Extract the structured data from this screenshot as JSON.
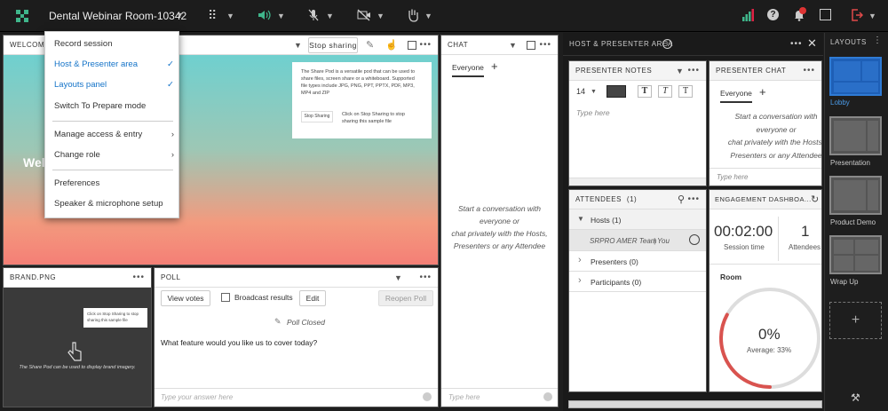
{
  "topbar": {
    "room_title": "Dental Webinar Room-10342"
  },
  "share_pod": {
    "header": "WELCOME...",
    "stop_sharing": "Stop sharing",
    "welcome_partial": "Welc",
    "note_lines": [
      "The Share Pod is a versatile pod that can be used to",
      "share files, screen share or a whiteboard. Supported",
      "file types include JPG, PNG, PPT, PPTX, PDF, MP3,",
      "MP4 and ZIP"
    ],
    "note_btn": "Stop Sharing",
    "note_hint_lines": [
      "Click on Stop Sharing to stop",
      "sharing this sample file"
    ]
  },
  "menu": {
    "items": [
      {
        "label": "Record session",
        "checked": false
      },
      {
        "label": "Host & Presenter area",
        "checked": true
      },
      {
        "label": "Layouts panel",
        "checked": true
      },
      {
        "label": "Switch To Prepare mode"
      },
      {
        "label": "Manage access & entry"
      },
      {
        "label": "Change role"
      },
      {
        "label": "Preferences"
      },
      {
        "label": "Speaker & microphone setup"
      }
    ],
    "check": "✓",
    "arrow": "›"
  },
  "brand_pod": {
    "header": "BRAND.PNG",
    "hint_lines": [
      "Click on Stop Sharing to stop",
      "sharing this sample file"
    ],
    "caption": "The Share Pod can be used to display brand imagery."
  },
  "poll_pod": {
    "header": "POLL",
    "view_votes": "View votes",
    "broadcast": "Broadcast results",
    "edit": "Edit",
    "reopen": "Reopen Poll",
    "status": "Poll Closed",
    "question": "What feature would you like us to cover today?",
    "answer_placeholder": "Type your answer here"
  },
  "chat_pod": {
    "header": "CHAT",
    "tab": "Everyone",
    "plus": "+",
    "empty_lines": [
      "Start a conversation with",
      "everyone or",
      "chat privately with the Hosts,",
      "Presenters or any Attendee"
    ],
    "input_placeholder": "Type here"
  },
  "host_area": {
    "header": "HOST & PRESENTER AREA",
    "notes": {
      "header": "PRESENTER NOTES",
      "font_size": "14",
      "t1": "T",
      "t2": "T",
      "t3": "T",
      "placeholder": "Type here"
    },
    "pchat": {
      "header": "PRESENTER CHAT",
      "tab": "Everyone",
      "plus": "+",
      "empty_lines": [
        "Start a conversation with",
        "everyone or",
        "chat privately with the Hosts,",
        "Presenters or any Attendee"
      ],
      "input_placeholder": "Type here"
    },
    "attendees": {
      "header": "ATTENDEES",
      "count": "(1)",
      "hosts": "Hosts (1)",
      "member": "SRPRO AMER Team",
      "member_role": "| You",
      "presenters": "Presenters (0)",
      "participants": "Participants (0)"
    },
    "engagement": {
      "header": "ENGAGEMENT DASHBOA...",
      "session_time": "00:02:00",
      "session_label": "Session time",
      "attendees_count": "1",
      "attendees_label": "Attendees",
      "room": "Room",
      "percent": "0%",
      "average": "Average: 33%",
      "average_value": 33
    }
  },
  "layouts": {
    "header": "LAYOUTS",
    "items": [
      "Lobby",
      "Presentation",
      "Product Demo",
      "Wrap Up"
    ],
    "add": "+"
  }
}
